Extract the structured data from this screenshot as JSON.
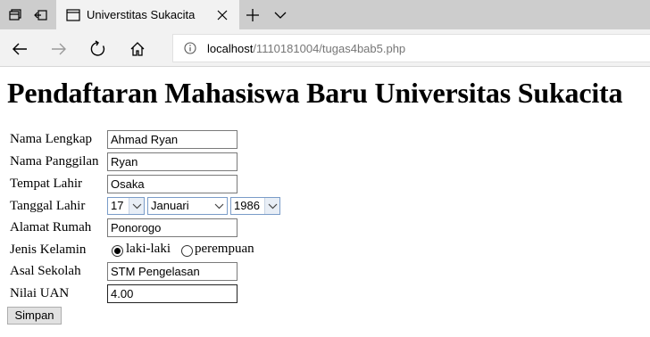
{
  "browser": {
    "tab_title": "Universtitas Sukacita",
    "url_host": "localhost",
    "url_path": "/1110181004/tugas4bab5.php",
    "icons": [
      "tab-set-icon",
      "tab-back-icon",
      "page-icon",
      "close-icon",
      "new-tab-icon",
      "chevron-down-icon",
      "back-icon",
      "forward-icon",
      "refresh-icon",
      "home-icon",
      "info-icon"
    ]
  },
  "page": {
    "heading": "Pendaftaran Mahasiswa Baru Universitas Sukacita",
    "form": {
      "nama_lengkap": {
        "label": "Nama Lengkap",
        "value": "Ahmad Ryan"
      },
      "nama_panggilan": {
        "label": "Nama Panggilan",
        "value": "Ryan"
      },
      "tempat_lahir": {
        "label": "Tempat Lahir",
        "value": "Osaka"
      },
      "tanggal_lahir": {
        "label": "Tanggal Lahir",
        "day": "17",
        "month": "Januari",
        "year": "1986"
      },
      "alamat_rumah": {
        "label": "Alamat Rumah",
        "value": "Ponorogo"
      },
      "jenis_kelamin": {
        "label": "Jenis Kelamin",
        "option_male": "laki-laki",
        "option_female": "perempuan",
        "selected": "laki-laki"
      },
      "asal_sekolah": {
        "label": "Asal Sekolah",
        "value": "STM Pengelasan"
      },
      "nilai_uan": {
        "label": "Nilai UAN",
        "value": "4.00"
      },
      "submit_label": "Simpan"
    }
  }
}
